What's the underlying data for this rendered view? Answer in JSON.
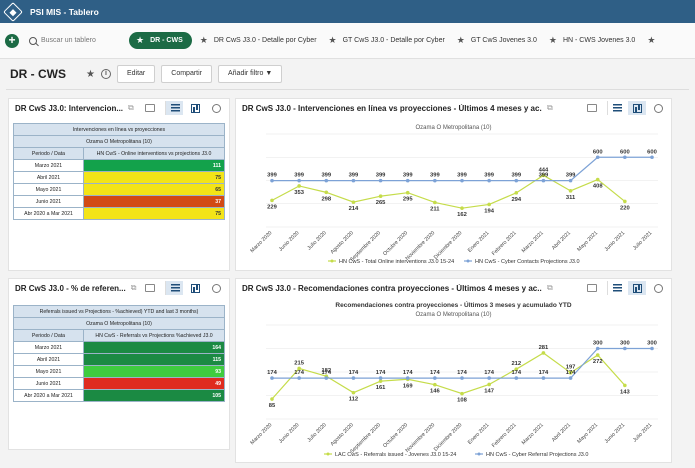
{
  "app": {
    "title": "PSI MIS - Tablero"
  },
  "tabbar": {
    "add_label": "+",
    "search_placeholder": "Buscar un tablero",
    "tabs": [
      {
        "label": "DR - CWS",
        "active": true
      },
      {
        "label": "DR CwS J3.0 - Detalle por Cyber"
      },
      {
        "label": "GT CwS J3.0 - Detalle por Cyber"
      },
      {
        "label": "GT CwS Jovenes 3.0"
      },
      {
        "label": "HN - CWS Jovenes 3.0"
      }
    ]
  },
  "header": {
    "title": "DR - CWS",
    "edit_label": "Editar",
    "share_label": "Compartir",
    "filter_label": "Añadir filtro ▼"
  },
  "panels": {
    "p1": {
      "title": "DR CwS J3.0: Intervencion...",
      "table_title": "Intervenciones en línea vs proyecciones",
      "org": "Ozama O Metropolitana (10)",
      "col1": "Periodo / Data",
      "col2": "HN CwS - Online interventions vs projections J3.0",
      "rows": [
        {
          "period": "Marzo 2021",
          "value": "111",
          "color": "#13a24b"
        },
        {
          "period": "Abril 2021",
          "value": "75",
          "color": "#f3e417"
        },
        {
          "period": "Mayo 2021",
          "value": "65",
          "color": "#f3e417"
        },
        {
          "period": "Junio 2021",
          "value": "37",
          "color": "#d24a14"
        },
        {
          "period": "Abr 2020 a Mar 2021",
          "value": "75",
          "color": "#f3e417"
        }
      ]
    },
    "p2": {
      "title": "DR CwS J3.0 - Intervenciones en línea vs proyecciones - Últimos 4 meses y ac...",
      "subtitle": "Ozama O Metropolitana (10)",
      "legend1": "HN CwS - Total Online interventions J3.0 15-24",
      "legend2": "HN CwS - Cyber Contacts Projections J3.0"
    },
    "p3": {
      "title": "DR CwS J3.0 - % de referen...",
      "table_title": "Referrals issued vs Projections - %achieved) YTD and last 3 months)",
      "org": "Ozama O Metropolitana (10)",
      "col1": "Periodo / Data",
      "col2": "HN CwS - Referrals vs Projections %achieved J3.0",
      "rows": [
        {
          "period": "Marzo 2021",
          "value": "164",
          "color": "#1b8a43"
        },
        {
          "period": "Abril 2021",
          "value": "115",
          "color": "#1b8a43"
        },
        {
          "period": "Mayo 2021",
          "value": "93",
          "color": "#3fcc3f"
        },
        {
          "period": "Junio 2021",
          "value": "49",
          "color": "#df2b1f"
        },
        {
          "period": "Abr 2020 a Mar 2021",
          "value": "105",
          "color": "#1b8a43"
        }
      ]
    },
    "p4": {
      "title": "DR CwS J3.0 - Recomendaciones contra proyecciones - Últimos 4 meses y ac...",
      "chart_title": "Recomendaciones contra proyecciones - Últimos 3 meses y acumulado YTD",
      "subtitle": "Ozama O Metropolitana (10)",
      "legend1": "LAC CwS - Referrals issued - Jovenes J3.0 15-24",
      "legend2": "HN CwS - Cyber Referral Projections J3.0"
    }
  },
  "chart_data": [
    {
      "type": "line",
      "categories": [
        "Marzo 2020",
        "Junio 2020",
        "Julio 2020",
        "Agosto 2020",
        "Septiembre 2020",
        "Octubre 2020",
        "Noviembre 2020",
        "Diciembre 2020",
        "Enero 2021",
        "Febrero 2021",
        "Marzo 2021",
        "Abril 2021",
        "Mayo 2021",
        "Junio 2021",
        "Julio 2021"
      ],
      "series": [
        {
          "name": "HN CwS - Total Online interventions J3.0 15-24",
          "color": "#c5dc4a",
          "values": [
            229,
            353,
            298,
            214,
            265,
            295,
            211,
            162,
            194,
            294,
            444,
            311,
            408,
            220,
            null
          ]
        },
        {
          "name": "HN CwS - Cyber Contacts Projections J3.0",
          "color": "#7da2d6",
          "values": [
            399,
            399,
            399,
            399,
            399,
            399,
            399,
            399,
            399,
            399,
            399,
            399,
            600,
            600,
            600
          ]
        }
      ],
      "ylim": [
        0,
        800
      ]
    },
    {
      "type": "line",
      "categories": [
        "Marzo 2020",
        "Junio 2020",
        "Julio 2020",
        "Agosto 2020",
        "Septiembre 2020",
        "Octubre 2020",
        "Noviembre 2020",
        "Diciembre 2020",
        "Enero 2021",
        "Febrero 2021",
        "Marzo 2021",
        "Abril 2021",
        "Mayo 2021",
        "Junio 2021",
        "Julio 2021"
      ],
      "series": [
        {
          "name": "LAC CwS - Referrals issued - Jovenes J3.0 15-24",
          "color": "#c5dc4a",
          "values": [
            85,
            215,
            182,
            112,
            161,
            169,
            146,
            108,
            147,
            212,
            281,
            197,
            272,
            143,
            null
          ]
        },
        {
          "name": "HN CwS - Cyber Referral Projections J3.0",
          "color": "#7da2d6",
          "values": [
            174,
            174,
            174,
            174,
            174,
            174,
            174,
            174,
            174,
            174,
            174,
            174,
            300,
            300,
            300
          ]
        }
      ],
      "ylim": [
        0,
        400
      ]
    }
  ]
}
